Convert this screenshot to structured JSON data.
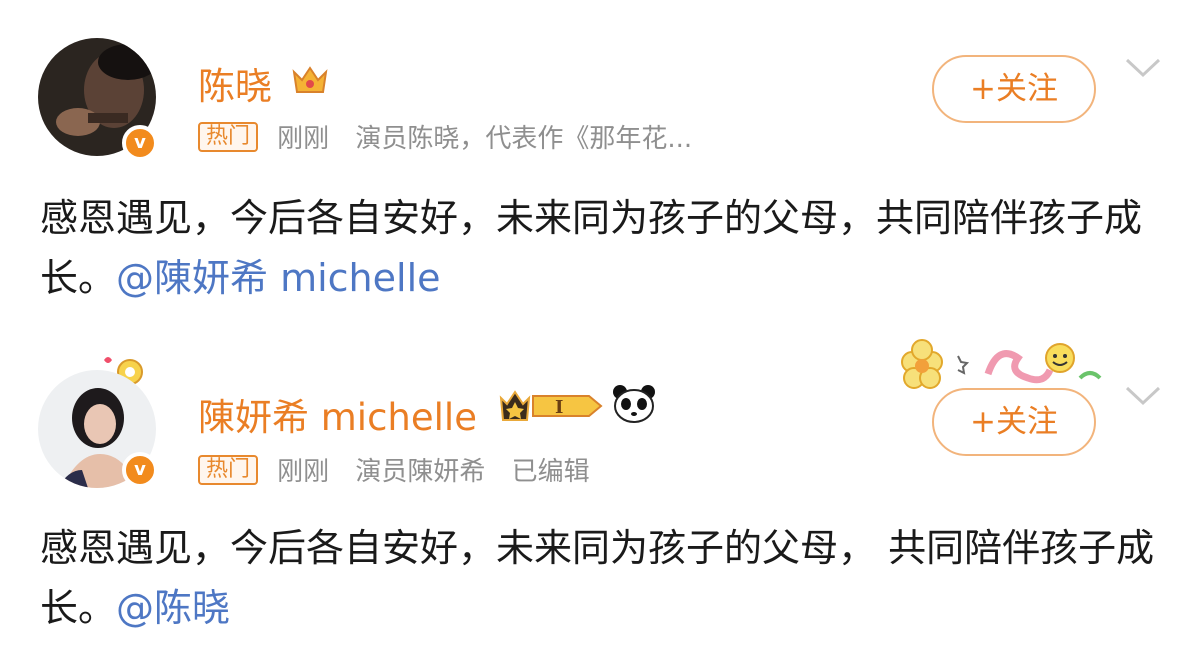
{
  "posts": [
    {
      "username": "陈晓",
      "hot_tag": "热门",
      "time": "刚刚",
      "bio": "演员陈晓，代表作《那年花...",
      "follow_label": "+关注",
      "content_text": "感恩遇见，今后各自安好，未来同为孩子的父母，共同陪伴孩子成长。",
      "mention": "@陳妍希 michelle",
      "verified_mark": "v"
    },
    {
      "username": "陳妍希 michelle",
      "hot_tag": "热门",
      "time": "刚刚",
      "bio": "演员陳妍希",
      "edited": "已编辑",
      "follow_label": "+关注",
      "content_text": "感恩遇见，今后各自安好，未来同为孩子的父母， 共同陪伴孩子成长。",
      "mention": "@陈晓",
      "vip_level": "I",
      "verified_mark": "v"
    }
  ],
  "icons": {
    "crown": "crown-icon",
    "vip": "vip-level-badge-icon",
    "panda": "panda-icon",
    "chevron": "chevron-down-icon",
    "decor": "flower-smiley-decoration"
  },
  "colors": {
    "username": "#ea7e24",
    "mention": "#4e77c4",
    "meta": "#8f8f8f",
    "verified": "#f28b1d"
  }
}
